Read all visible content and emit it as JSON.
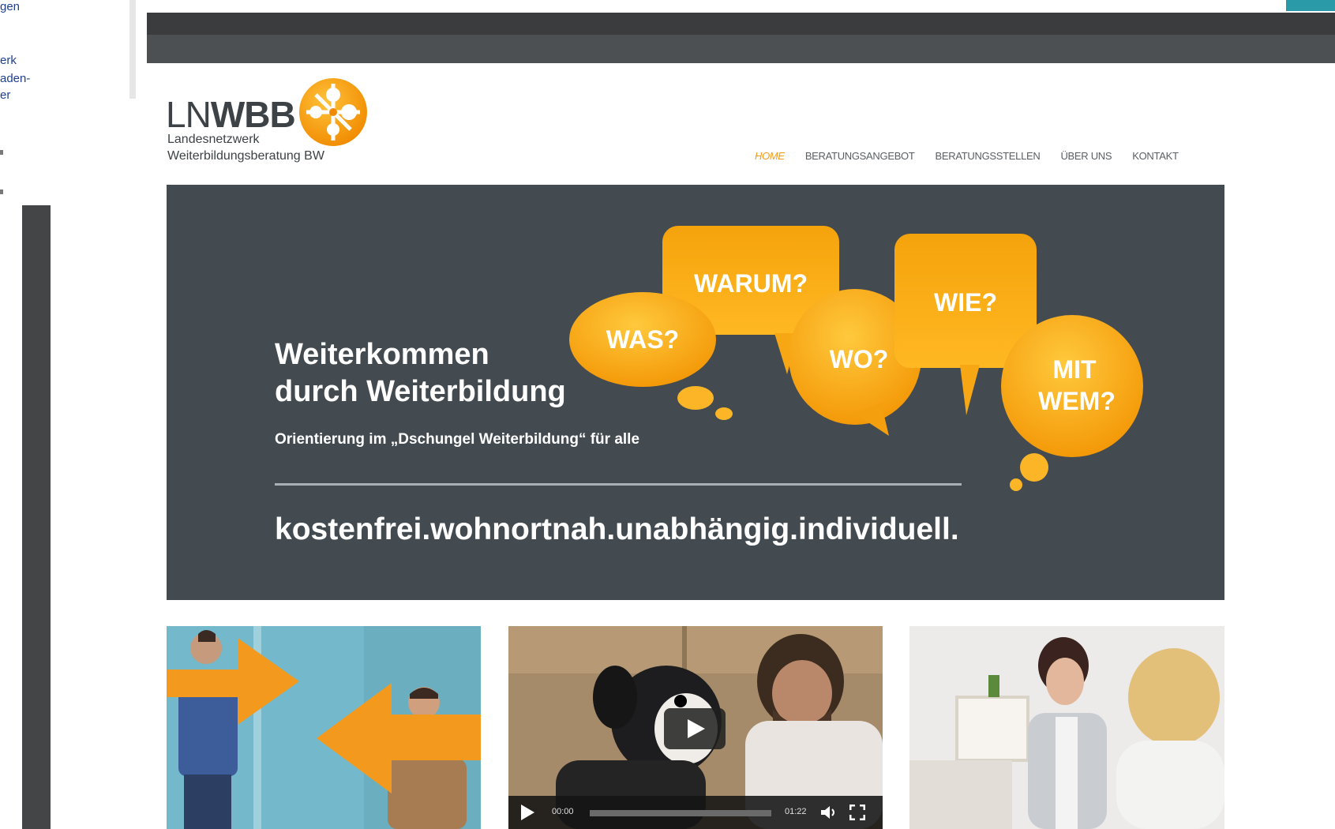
{
  "left_panel": {
    "fragments": [
      "gen",
      "erk",
      "aden-",
      "er"
    ]
  },
  "header": {
    "logo": {
      "light": "LN",
      "bold": "WBB",
      "line1": "Landesnetzwerk",
      "line2": "Weiterbildungsberatung BW"
    },
    "nav": [
      "HOME",
      "BERATUNGSANGEBOT",
      "BERATUNGSSTELLEN",
      "ÜBER UNS",
      "KONTAKT"
    ],
    "nav_active_index": 0
  },
  "hero": {
    "title_line1": "Weiterkommen",
    "title_line2": "durch Weiterbildung",
    "subtitle": "Orientierung im „Dschungel Weiterbildung“ für alle",
    "tagline": "kostenfrei.wohnortnah.unabhängig.individuell.",
    "bubbles": [
      "WAS?",
      "WARUM?",
      "WO?",
      "WIE?",
      "MIT",
      "WEM?"
    ]
  },
  "video": {
    "current_time": "00:00",
    "duration": "01:22"
  },
  "colors": {
    "accent_orange": "#f29a1a",
    "hero_bg": "#434b50",
    "teal": "#2a9aa8"
  }
}
